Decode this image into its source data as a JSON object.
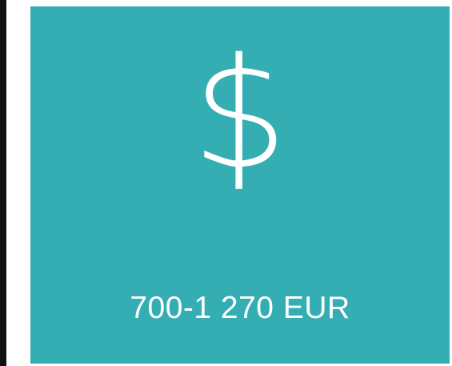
{
  "card": {
    "icon": "dollar-sign-icon",
    "symbol": "$",
    "price_range": "700-1 270 EUR",
    "background_color": "#34aeb3",
    "text_color": "#ffffff"
  },
  "page": {
    "left_bar_color": "#111111"
  }
}
